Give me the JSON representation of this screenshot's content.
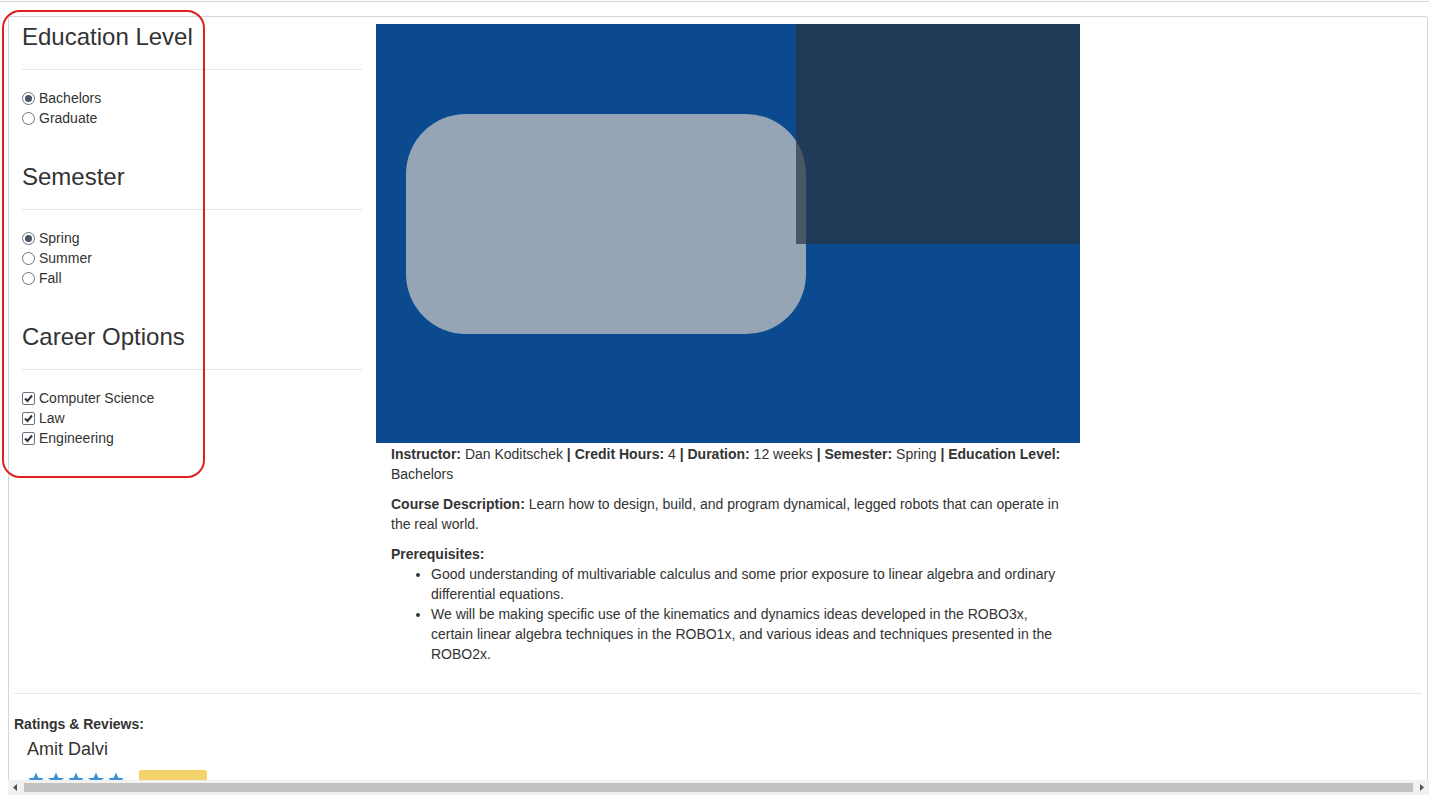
{
  "sidebar": {
    "groups": [
      {
        "title": "Education Level",
        "kind": "radio",
        "options": [
          {
            "label": "Bachelors",
            "selected": true
          },
          {
            "label": "Graduate",
            "selected": false
          }
        ]
      },
      {
        "title": "Semester",
        "kind": "radio",
        "options": [
          {
            "label": "Spring",
            "selected": true
          },
          {
            "label": "Summer",
            "selected": false
          },
          {
            "label": "Fall",
            "selected": false
          }
        ]
      },
      {
        "title": "Career Options",
        "kind": "checkbox",
        "options": [
          {
            "label": "Computer Science",
            "selected": true
          },
          {
            "label": "Law",
            "selected": true
          },
          {
            "label": "Engineering",
            "selected": true
          }
        ]
      }
    ]
  },
  "course": {
    "facts": [
      {
        "label": "Instructor:",
        "value": "Dan Koditschek"
      },
      {
        "label": "Credit Hours:",
        "value": "4"
      },
      {
        "label": "Duration:",
        "value": "12 weeks"
      },
      {
        "label": "Semester:",
        "value": "Spring"
      },
      {
        "label": "Education Level:",
        "value": "Bachelors"
      }
    ],
    "separator": "|",
    "description": {
      "label": "Course Description:",
      "value": "Learn how to design, build, and program dynamical, legged robots that can operate in the real world."
    },
    "prerequisites": {
      "label": "Prerequisites:",
      "items": [
        "Good understanding of multivariable calculus and some prior exposure to linear algebra and ordinary differential equations.",
        "We will be making specific use of the kinematics and dynamics ideas developed in the ROBO3x, certain linear algebra techniques in the ROBO1x, and various ideas and techniques presented in the ROBO2x."
      ]
    }
  },
  "reviews": {
    "title": "Ratings & Reviews:",
    "items": [
      {
        "name": "Amit Dalvi",
        "stars": 5
      }
    ]
  }
}
